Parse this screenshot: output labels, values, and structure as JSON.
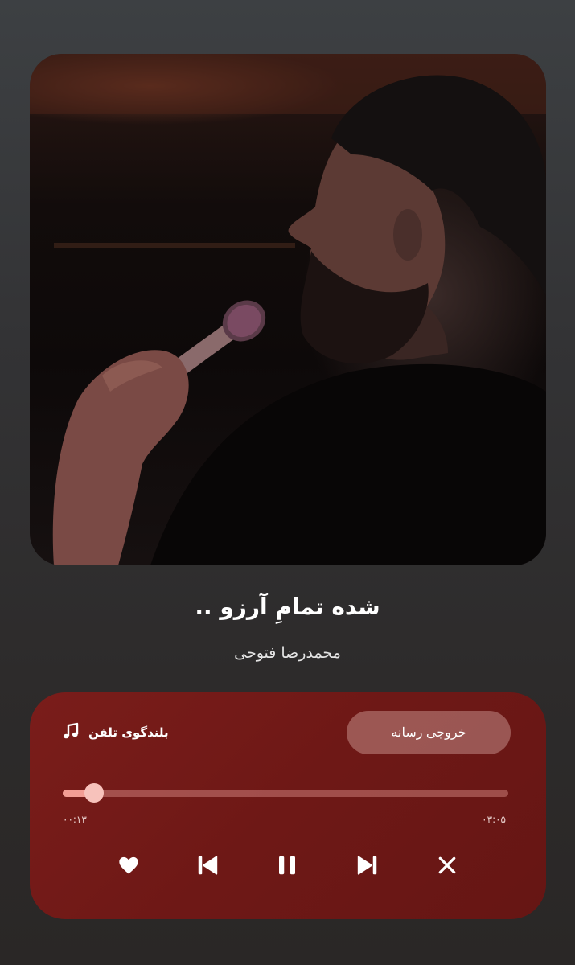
{
  "track": {
    "title": "شده تمامِ آرزو ..",
    "artist": "محمدرضا فتوحی"
  },
  "media_panel": {
    "device_label": "بلندگوی تلفن",
    "output_button_label": "خروجی رسانه",
    "elapsed_time": "۰۰:۱۳",
    "total_time": "۰۳:۰۵",
    "progress_fraction": 0.07
  },
  "controls": [
    "heart-icon",
    "previous-icon",
    "pause-icon",
    "next-icon",
    "close-icon"
  ],
  "colors": {
    "panel": "#6e1816",
    "progress_fill": "#f29d94",
    "thumb": "#f7c2bb"
  }
}
